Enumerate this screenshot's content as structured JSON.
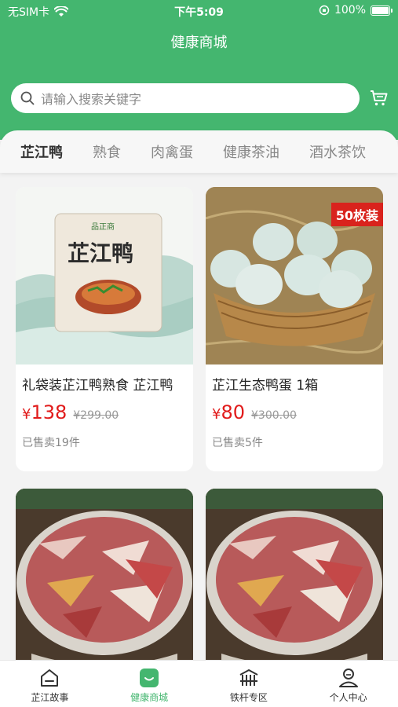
{
  "status_bar": {
    "carrier": "无SIM卡",
    "time": "下午5:09",
    "battery": "100%"
  },
  "header": {
    "title": "健康商城"
  },
  "search": {
    "placeholder": "请输入搜索关键字"
  },
  "categories": [
    {
      "label": "芷江鸭",
      "active": true
    },
    {
      "label": "熟食",
      "active": false
    },
    {
      "label": "肉禽蛋",
      "active": false
    },
    {
      "label": "健康茶油",
      "active": false
    },
    {
      "label": "酒水茶饮",
      "active": false
    }
  ],
  "products": [
    {
      "name": "礼袋装芷江鸭熟食 芷江鸭",
      "price": "138",
      "currency": "¥",
      "original_price": "¥299.00",
      "sold": "已售卖19件",
      "package_text": "芷江鸭",
      "brand_text": "品正商"
    },
    {
      "name": "芷江生态鸭蛋 1箱",
      "price": "80",
      "currency": "¥",
      "original_price": "¥300.00",
      "sold": "已售卖5件",
      "badge": "50枚装"
    }
  ],
  "tabbar": [
    {
      "label": "芷江故事",
      "icon": "story-icon",
      "active": false
    },
    {
      "label": "健康商城",
      "icon": "shop-icon",
      "active": true
    },
    {
      "label": "铁杆专区",
      "icon": "fan-zone-icon",
      "active": false
    },
    {
      "label": "个人中心",
      "icon": "profile-icon",
      "active": false
    }
  ],
  "colors": {
    "brand_green": "#44b66f",
    "price_red": "#e11b1b",
    "badge_red": "#d9231d"
  }
}
